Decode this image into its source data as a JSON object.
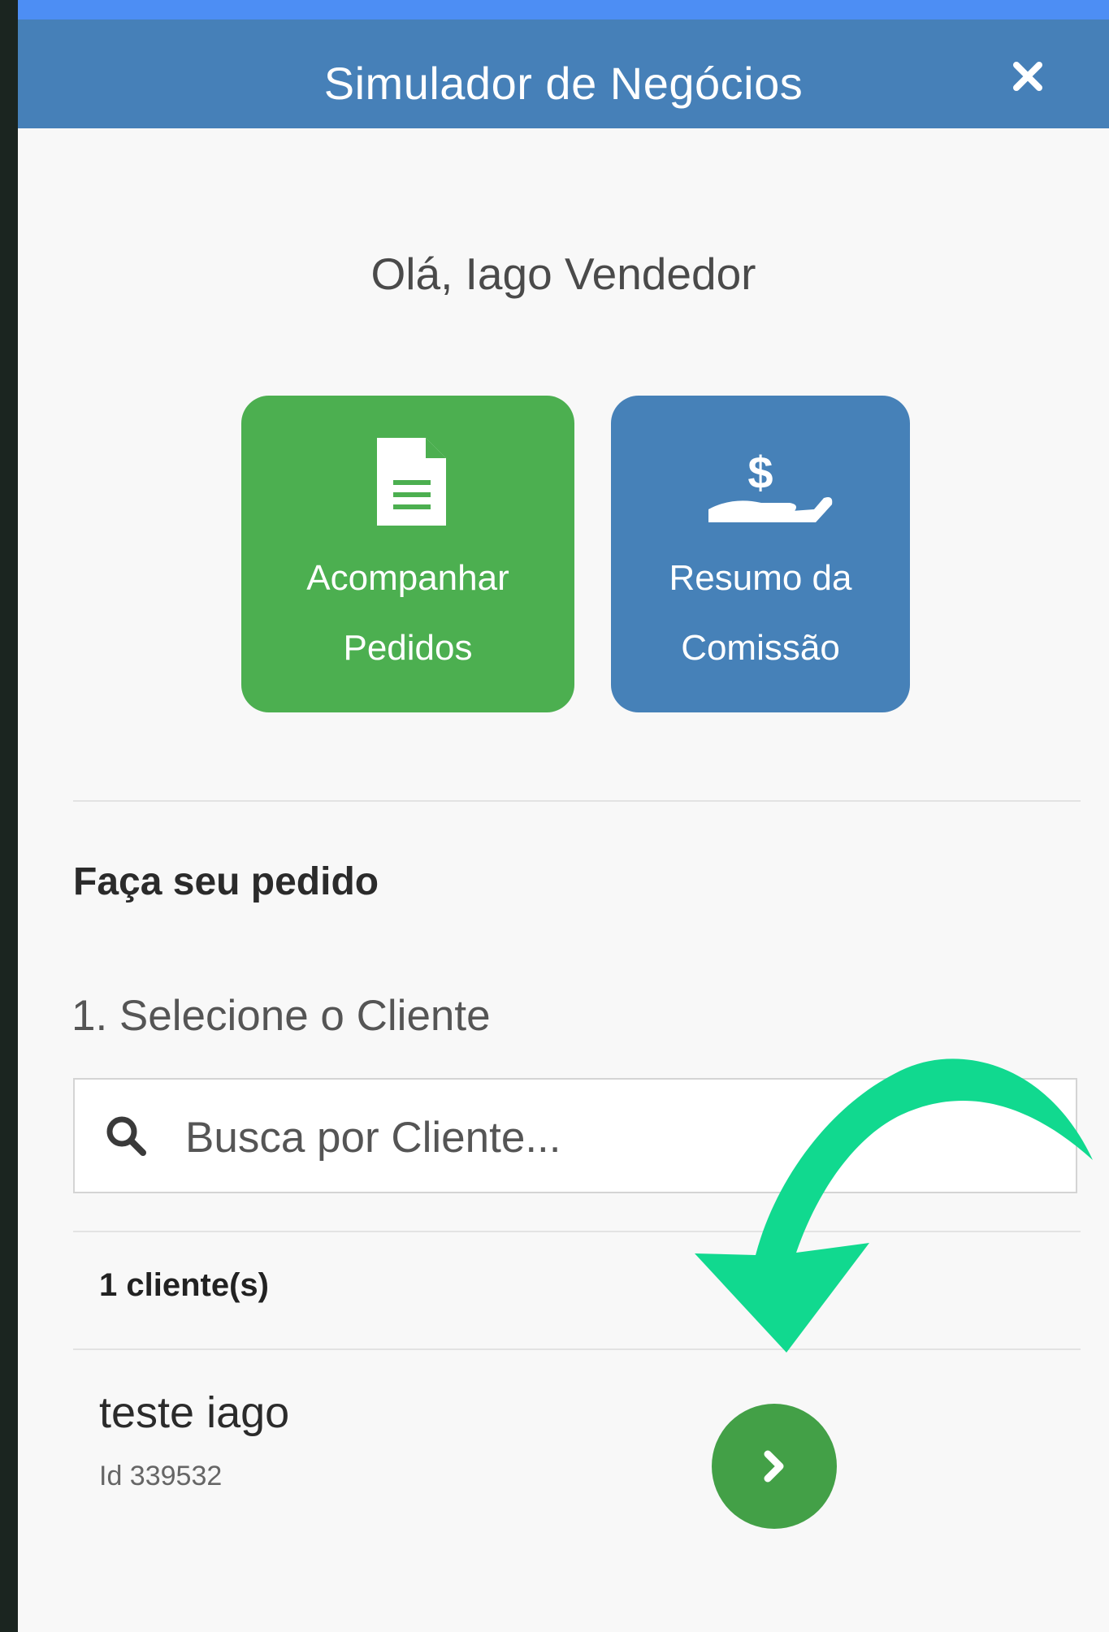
{
  "header": {
    "title": "Simulador de Negócios",
    "close_icon": "close-icon",
    "color": "#4680b8",
    "top_strip_color": "#4d8ef4"
  },
  "greeting": "Olá, Iago Vendedor",
  "tiles": [
    {
      "label_line1": "Acompanhar",
      "label_line2": "Pedidos",
      "icon": "document-icon",
      "color": "#4caf50"
    },
    {
      "label_line1": "Resumo da",
      "label_line2": "Comissão",
      "icon": "hand-dollar-icon",
      "color": "#4681b8"
    }
  ],
  "order_section": {
    "title": "Faça seu pedido",
    "step_label": "1. Selecione o Cliente",
    "search": {
      "placeholder": "Busca por Cliente...",
      "value": "",
      "icon": "search-icon"
    },
    "count_label": "1 cliente(s)",
    "clients": [
      {
        "name": "teste iago",
        "id_label": "Id 339532",
        "action_icon": "chevron-right-icon"
      }
    ]
  },
  "annotation": {
    "icon": "curved-arrow-icon",
    "color": "#11d98f"
  }
}
